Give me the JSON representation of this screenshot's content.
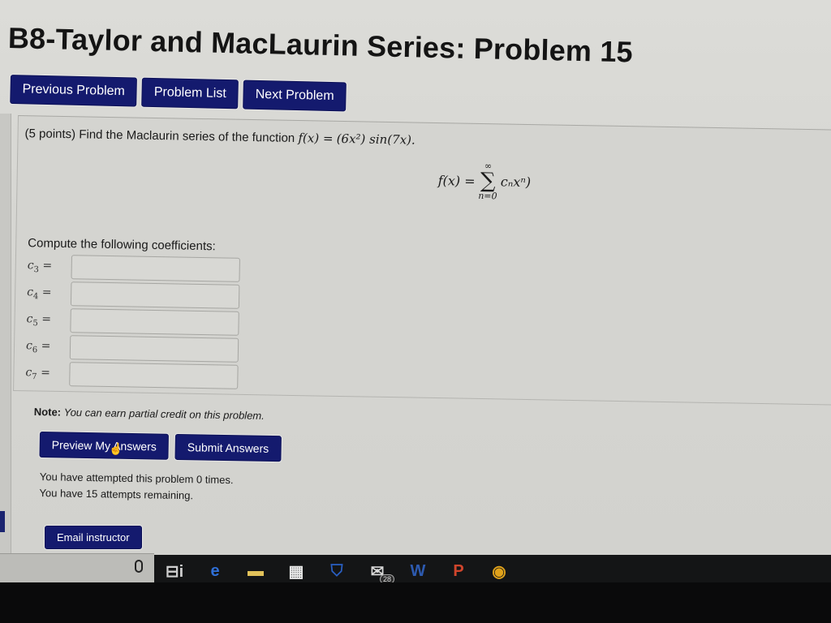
{
  "page": {
    "title": "B8-Taylor and MacLaurin Series: Problem 15"
  },
  "nav": {
    "previous": "Previous Problem",
    "list": "Problem List",
    "next": "Next Problem"
  },
  "problem": {
    "points": "(5 points)",
    "prompt": "Find the Maclaurin series of the function",
    "function_lhs": "f(x) =",
    "function_rhs": "(6x²) sin(7x).",
    "series_lhs": "f(x) =",
    "series_sum_upper": "∞",
    "series_sum_symbol": "∑",
    "series_sum_lower": "n=0",
    "series_term": "cₙxⁿ)",
    "compute_label": "Compute the following coefficients:",
    "coefficients": [
      {
        "label": "c",
        "sub": "3",
        "eq": "=",
        "value": ""
      },
      {
        "label": "c",
        "sub": "4",
        "eq": "=",
        "value": ""
      },
      {
        "label": "c",
        "sub": "5",
        "eq": "=",
        "value": ""
      },
      {
        "label": "c",
        "sub": "6",
        "eq": "=",
        "value": ""
      },
      {
        "label": "c",
        "sub": "7",
        "eq": "=",
        "value": ""
      }
    ]
  },
  "note": {
    "label": "Note:",
    "text": "You can earn partial credit on this problem."
  },
  "actions": {
    "preview": "Preview My Answers",
    "submit": "Submit Answers"
  },
  "attempts": {
    "line1": "You have attempted this problem 0 times.",
    "line2": "You have 15 attempts remaining."
  },
  "email": {
    "label": "Email instructor"
  },
  "taskbar": {
    "items": [
      {
        "name": "task-view",
        "glyph": "⊟i",
        "color": "#cfcfcf",
        "active": false
      },
      {
        "name": "edge",
        "glyph": "e",
        "color": "#2f6fd6",
        "active": true
      },
      {
        "name": "file-explorer",
        "glyph": "▬",
        "color": "#e2c25a",
        "active": false
      },
      {
        "name": "store",
        "glyph": "▦",
        "color": "#e8e8e8",
        "active": false
      },
      {
        "name": "security-app",
        "glyph": "⛉",
        "color": "#2a5fc2",
        "active": false
      },
      {
        "name": "mail",
        "glyph": "✉",
        "color": "#d8d8d8",
        "active": true,
        "badge": "28"
      },
      {
        "name": "word",
        "glyph": "W",
        "color": "#2d5ab0",
        "active": true
      },
      {
        "name": "powerpoint",
        "glyph": "P",
        "color": "#d0452c",
        "active": true
      },
      {
        "name": "chrome",
        "glyph": "◉",
        "color": "#e0a21b",
        "active": true
      }
    ]
  }
}
